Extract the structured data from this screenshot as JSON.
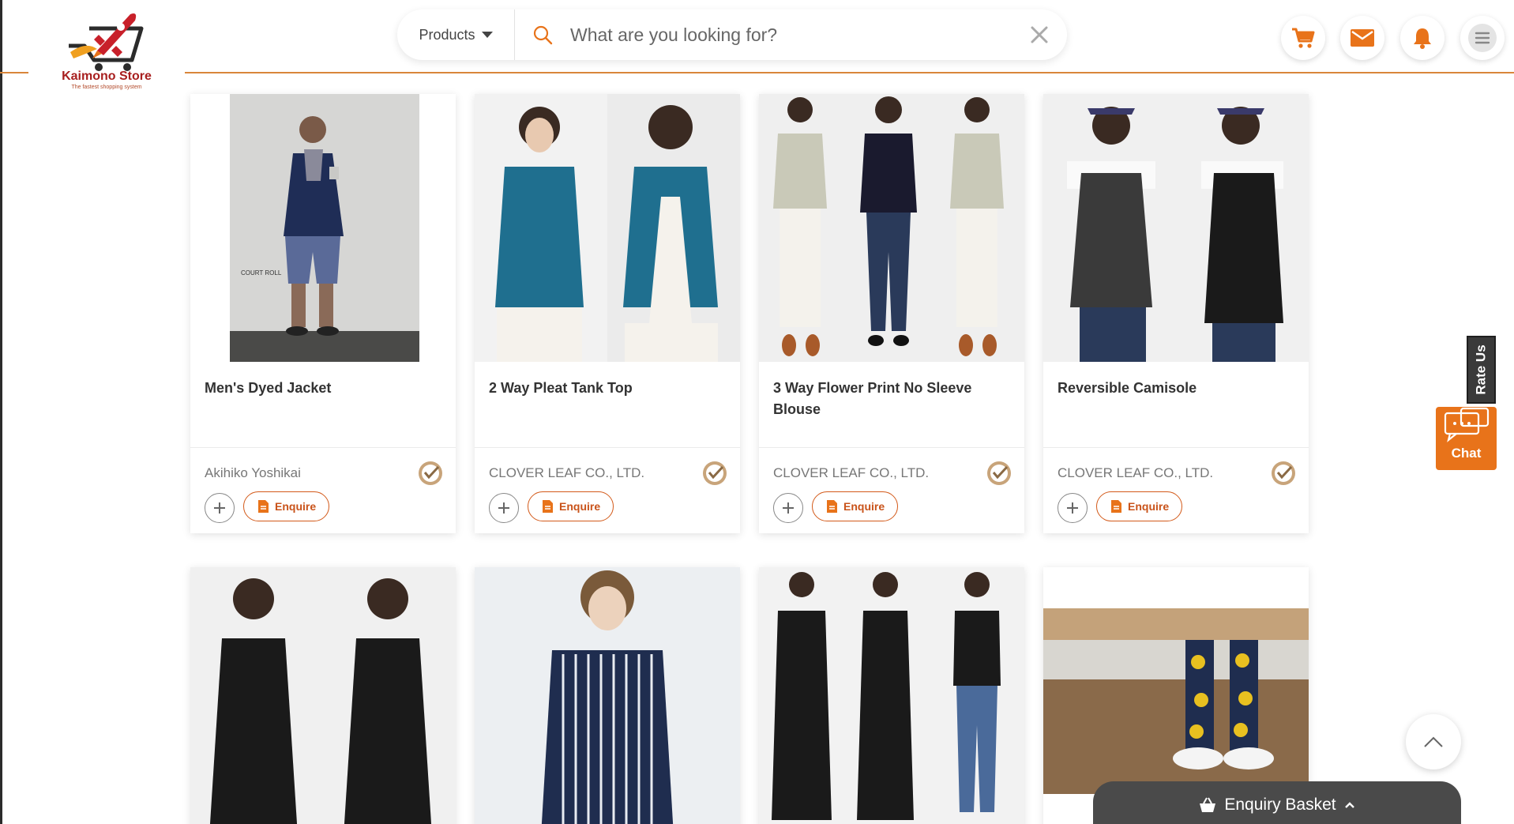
{
  "store": {
    "name": "Kaimono Store",
    "tagline": "The fastest shopping system"
  },
  "search": {
    "category": "Products",
    "placeholder": "What are you looking for?"
  },
  "products_row1": [
    {
      "title": "Men's Dyed Jacket",
      "supplier": "Akihiko Yoshikai",
      "image": "mens-jacket-photo",
      "image_text": "COURT ROLL"
    },
    {
      "title": "2 Way Pleat Tank Top",
      "supplier": "CLOVER LEAF CO., LTD.",
      "image": "tank-top-photo"
    },
    {
      "title": "3 Way Flower Print No Sleeve Blouse",
      "supplier": "CLOVER LEAF CO., LTD.",
      "image": "flower-blouse-photo"
    },
    {
      "title": "Reversible Camisole",
      "supplier": "CLOVER LEAF CO., LTD.",
      "image": "camisole-photo"
    }
  ],
  "products_row2": [
    {
      "image": "black-dress-photo"
    },
    {
      "image": "striped-top-photo"
    },
    {
      "image": "black-outfit-photo"
    },
    {
      "image": "flower-socks-photo"
    }
  ],
  "actions": {
    "enquire_label": "Enquire"
  },
  "widgets": {
    "rate_us": "Rate Us",
    "chat": "Chat",
    "basket": "Enquiry Basket"
  },
  "colors": {
    "brand": "#e8731a",
    "accent_line": "#d9863a",
    "logo_red": "#a81f1f",
    "dark": "#4a4a4a"
  }
}
